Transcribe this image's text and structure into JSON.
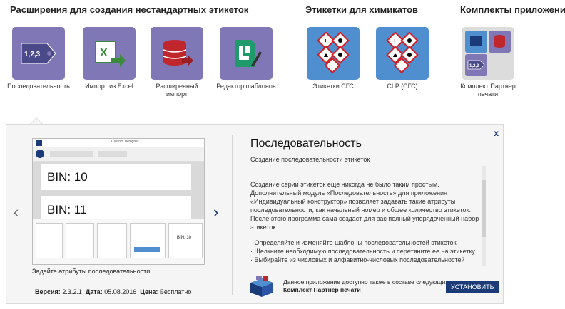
{
  "sections": {
    "custom": "Расширения для создания нестандартных этикеток",
    "chem": "Этикетки для химикатов",
    "kits": "Комплекты приложений"
  },
  "tiles": [
    {
      "label": "Последовательность",
      "icon": "sequence-tag-icon"
    },
    {
      "label": "Импорт из Excel",
      "icon": "excel-import-icon"
    },
    {
      "label": "Расширенный импорт",
      "icon": "database-import-icon"
    },
    {
      "label": "Редактор шаблонов",
      "icon": "template-editor-icon"
    },
    {
      "label": "Этикетки СГС",
      "icon": "ghs-hazard-icon"
    },
    {
      "label": "CLP (СГС)",
      "icon": "clp-hazard-icon"
    },
    {
      "label": "Комплект Партнер печати",
      "icon": "kit-icon"
    }
  ],
  "detail": {
    "title": "Последовательность",
    "subtitle": "Создание последовательности этикеток",
    "paragraph": "Создание серии этикеток еще никогда не было таким простым. Дополнительный модуль «Последовательность» для приложения «Индивидуальный конструктор» позволяет задавать такие атрибуты последовательности, как начальный номер и общее количество этикеток. После этого программа сама создаст для вас полный упорядоченный набор этикеток.",
    "bullets": [
      "· Определяйте и изменяйте шаблоны последовательностей этикеток",
      "· Щелкните необходимую последовательность и перетяните ее на этикетку",
      "· Выбирайте из числовых и алфавитно-числовых последовательностей"
    ],
    "screenshot_caption": "Задайте атрибуты последовательности",
    "screenshot_text": {
      "app_title": "Custom Designer",
      "bin1": "BIN: 10",
      "bin2": "BIN: 11",
      "bin_small": "BIN: 10"
    },
    "version_label": "Версия:",
    "version": "2.3.2.1",
    "date_label": "Дата:",
    "date": "05.08.2016",
    "price_label": "Цена:",
    "price": "Бесплатно",
    "kit_note_prefix": "Данное приложение доступно также в составе следующих комплектов:",
    "kit_name": "Комплект Партнер печати",
    "install_button": "УСТАНОВИТЬ",
    "close": "x",
    "prev": "‹",
    "next": "›"
  },
  "colors": {
    "purple_tile": "#7f77b6",
    "ghs_tile": "#4f8fd0",
    "brand_blue": "#1a3a78"
  }
}
